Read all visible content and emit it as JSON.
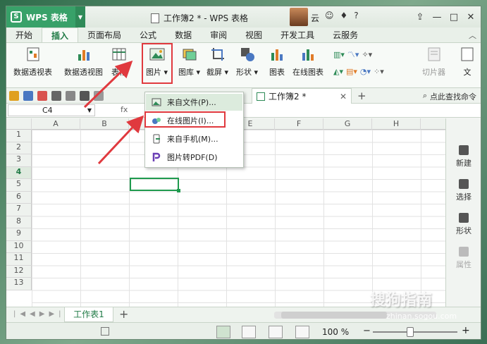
{
  "app": {
    "name": "WPS 表格",
    "doc_title": "工作簿2 * - WPS 表格",
    "user": "云"
  },
  "menu": {
    "tabs": [
      "开始",
      "插入",
      "页面布局",
      "公式",
      "数据",
      "审阅",
      "视图",
      "开发工具",
      "云服务"
    ],
    "active": "插入"
  },
  "ribbon": {
    "pivot_table": "数据透视表",
    "pivot_chart": "数据透视图",
    "table": "表格",
    "picture": "图片",
    "library": "图库",
    "screenshot": "截屏",
    "shapes": "形状",
    "chart": "图表",
    "online_chart": "在线图表",
    "slicer": "切片器",
    "text": "文"
  },
  "doc_tab": {
    "label": "工作簿2 *"
  },
  "search_cmd": "点此查找命令",
  "formula": {
    "name_box": "C4",
    "fx": "fx"
  },
  "grid": {
    "columns": [
      "A",
      "B",
      "C",
      "D",
      "E",
      "F",
      "G",
      "H"
    ],
    "rows": [
      "1",
      "2",
      "3",
      "4",
      "5",
      "6",
      "7",
      "8",
      "9",
      "10",
      "11",
      "12",
      "13"
    ],
    "selected_cell": "C4"
  },
  "dropdown": {
    "items": [
      "来自文件(P)...",
      "在线图片(I)...",
      "来自手机(M)...",
      "图片转PDF(D)"
    ]
  },
  "side_panel": {
    "items": [
      "新建",
      "选择",
      "形状",
      "属性"
    ]
  },
  "sheet": {
    "tab": "工作表1"
  },
  "status": {
    "zoom": "100 %"
  },
  "watermark": {
    "text": "搜狗指南",
    "url": "zhinan.sogou.com"
  },
  "colors": {
    "accent": "#38a169",
    "highlight": "#e0393e"
  }
}
